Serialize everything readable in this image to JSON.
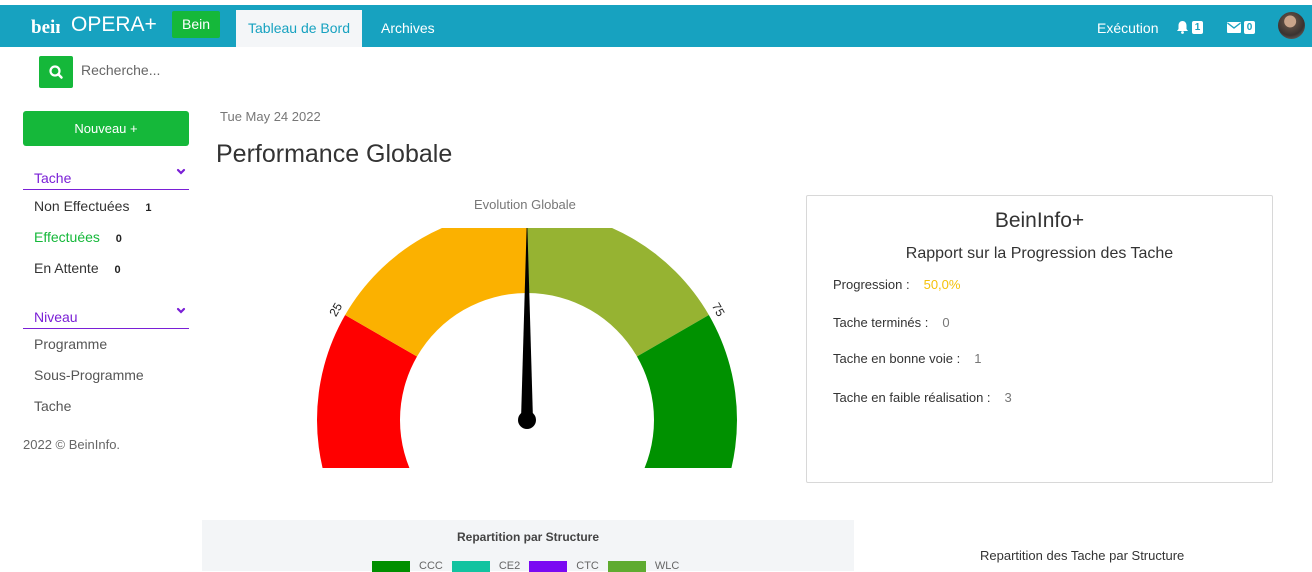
{
  "header": {
    "brand_logo_text": "bein",
    "brand_name": "OPERA+",
    "badge": "Bein",
    "tabs": [
      {
        "label": "Tableau de Bord",
        "active": true
      },
      {
        "label": "Archives",
        "active": false
      }
    ],
    "execution_label": "Exécution",
    "notifications_count": "1",
    "messages_count": "0",
    "bar_color": "#17a2c0"
  },
  "sidebar": {
    "search_placeholder": "Recherche...",
    "new_button": "Nouveau +",
    "tache_section": {
      "label": "Tache",
      "items": [
        {
          "label": "Non Effectuées",
          "count": "1"
        },
        {
          "label": "Effectuées",
          "count": "0"
        },
        {
          "label": "En Attente",
          "count": "0"
        }
      ]
    },
    "niveau_section": {
      "label": "Niveau",
      "items": [
        "Programme",
        "Sous-Programme",
        "Tache"
      ]
    },
    "footer": "2022 © BeinInfo.",
    "accent_color": "#7a1fd6",
    "green_color": "#15b83a"
  },
  "main": {
    "date": "Tue May 24 2022",
    "title": "Performance Globale",
    "gauge": {
      "title": "Evolution Globale",
      "min": 0,
      "max": 100,
      "value": 50,
      "ticks": [
        "0",
        "25",
        "50",
        "75",
        "100"
      ],
      "band_colors": [
        "#ff0000",
        "#fbb100",
        "#96b332",
        "#009100"
      ]
    }
  },
  "info_card": {
    "title": "BeinInfo+",
    "subtitle": "Rapport sur la Progression des Tache",
    "rows": [
      {
        "label": "Progression :",
        "value": "50,0%"
      },
      {
        "label": "Tache terminés :",
        "value": "0"
      },
      {
        "label": "Tache en bonne voie :",
        "value": "1"
      },
      {
        "label": "Tache en faible réalisation :",
        "value": "3"
      }
    ]
  },
  "bottom": {
    "structure_chart": {
      "title": "Repartition par Structure",
      "legend": [
        {
          "name": "CCC",
          "color": "#008f00"
        },
        {
          "name": "CE2",
          "color": "#12c3a0"
        },
        {
          "name": "CTC",
          "color": "#7a0af2"
        },
        {
          "name": "WLC",
          "color": "#5fab30"
        }
      ]
    },
    "right_title": "Repartition des Tache par Structure"
  }
}
